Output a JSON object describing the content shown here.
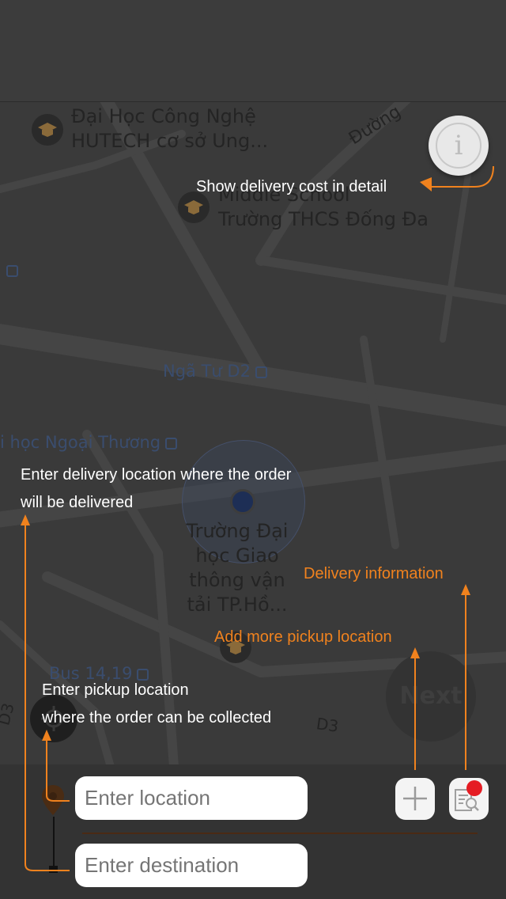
{
  "map": {
    "labels": {
      "hutech": "Đại Học Công Nghệ\nHUTECH cơ sở Ung...",
      "school": "Middle School\nTrường THCS Đống Đa",
      "road_duong": "Đường",
      "road_d3": "D3",
      "road_d3_street": "D3",
      "university": "Trường Đại\nhọc Giao\nthông vận\ntải TP.Hồ..."
    },
    "transit": {
      "nga_tu": "Ngã Tư D2",
      "ngoai_thuong": "i học Ngoại Thương",
      "bus": "Bus 14,19"
    }
  },
  "buttons": {
    "info_glyph": "i",
    "next_label": "Next"
  },
  "form": {
    "location_placeholder": "Enter location",
    "destination_placeholder": "Enter destination"
  },
  "tutorial": {
    "cost_detail": "Show delivery cost in detail",
    "delivery_location": "Enter delivery location where the order\nwill be delivered",
    "delivery_info": "Delivery information",
    "add_pickup": "Add more pickup location",
    "pickup_location": "Enter pickup location\nwhere the order can be collected"
  },
  "colors": {
    "accent": "#f0821e",
    "badge": "#e51c23",
    "input_bg": "#ffffff"
  },
  "icons": {
    "info": "info-icon",
    "plus": "plus-icon",
    "detail": "search-document-icon",
    "pin": "location-pin-icon",
    "target": "crosshair-icon",
    "poi": "graduation-cap-icon",
    "bus": "bus-stop-icon"
  }
}
